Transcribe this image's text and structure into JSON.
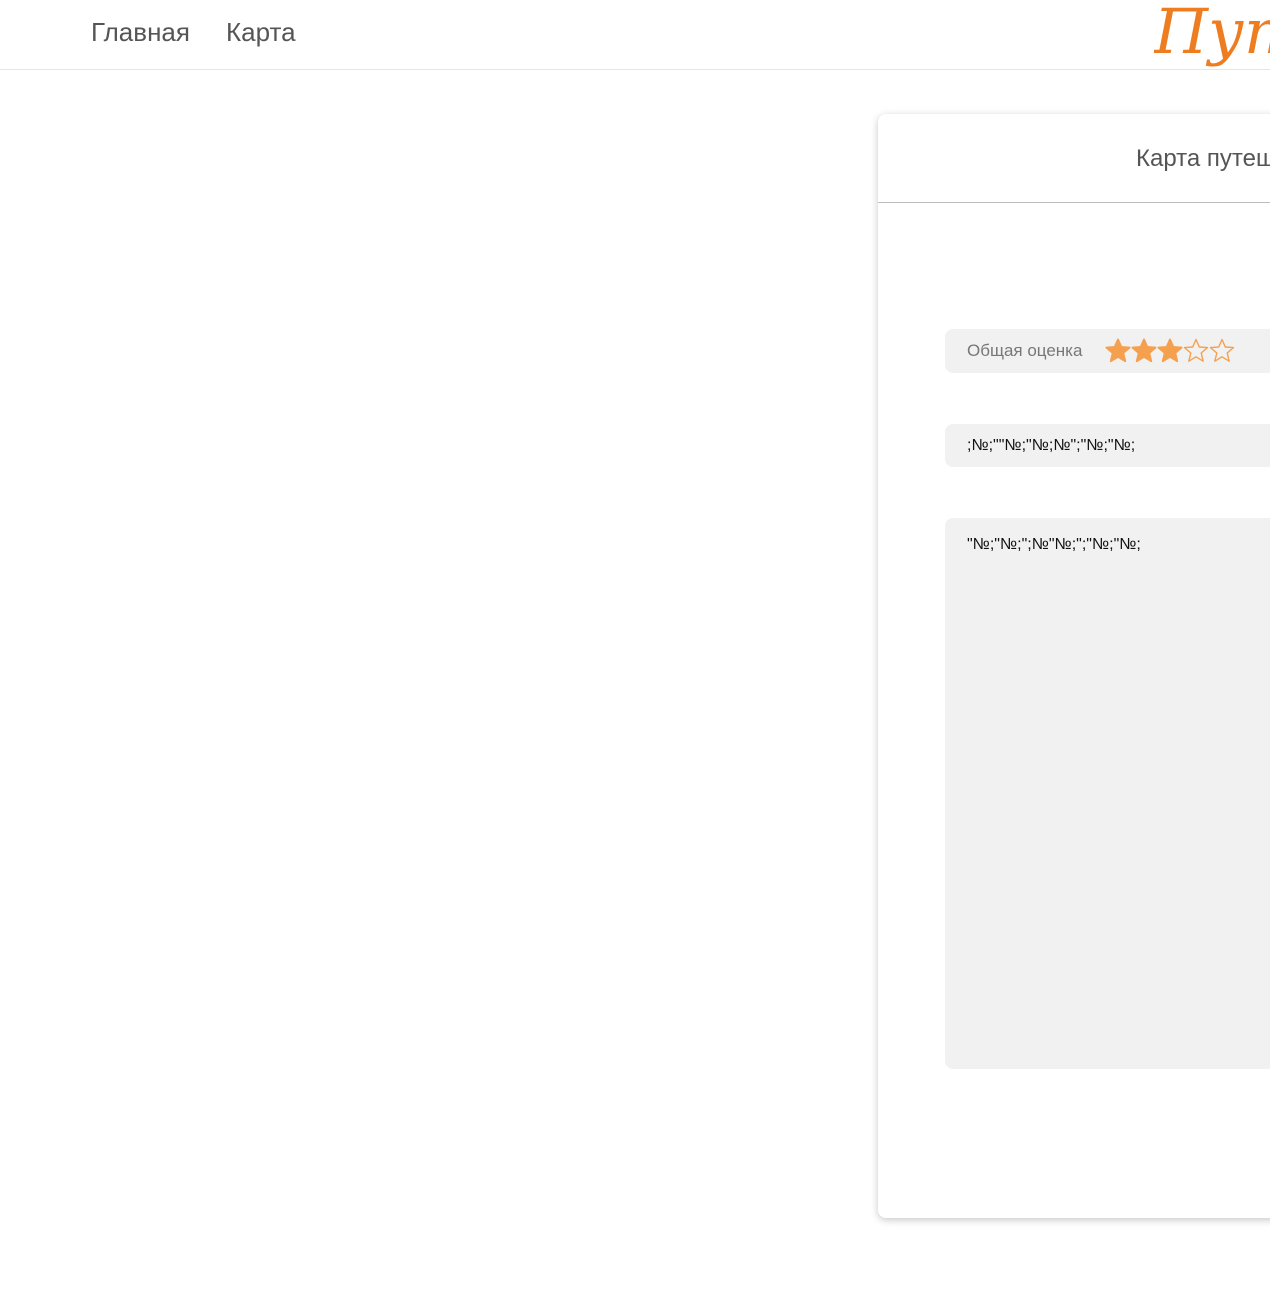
{
  "nav": {
    "home": "Главная",
    "map": "Карта"
  },
  "logo": {
    "text": "Путешествия",
    "color": "#ee7d22"
  },
  "card": {
    "title": "Карта путешествий"
  },
  "rating": {
    "label": "Общая оценка",
    "value": 3,
    "max": 5,
    "star_color": "#f5a04e"
  },
  "fields": {
    "title_value": ";№;\"\"№;\"№;№\";\"№;\"№;",
    "description_value": "\"№;\"№;\";№\"№;\";\"№;\"№;"
  }
}
